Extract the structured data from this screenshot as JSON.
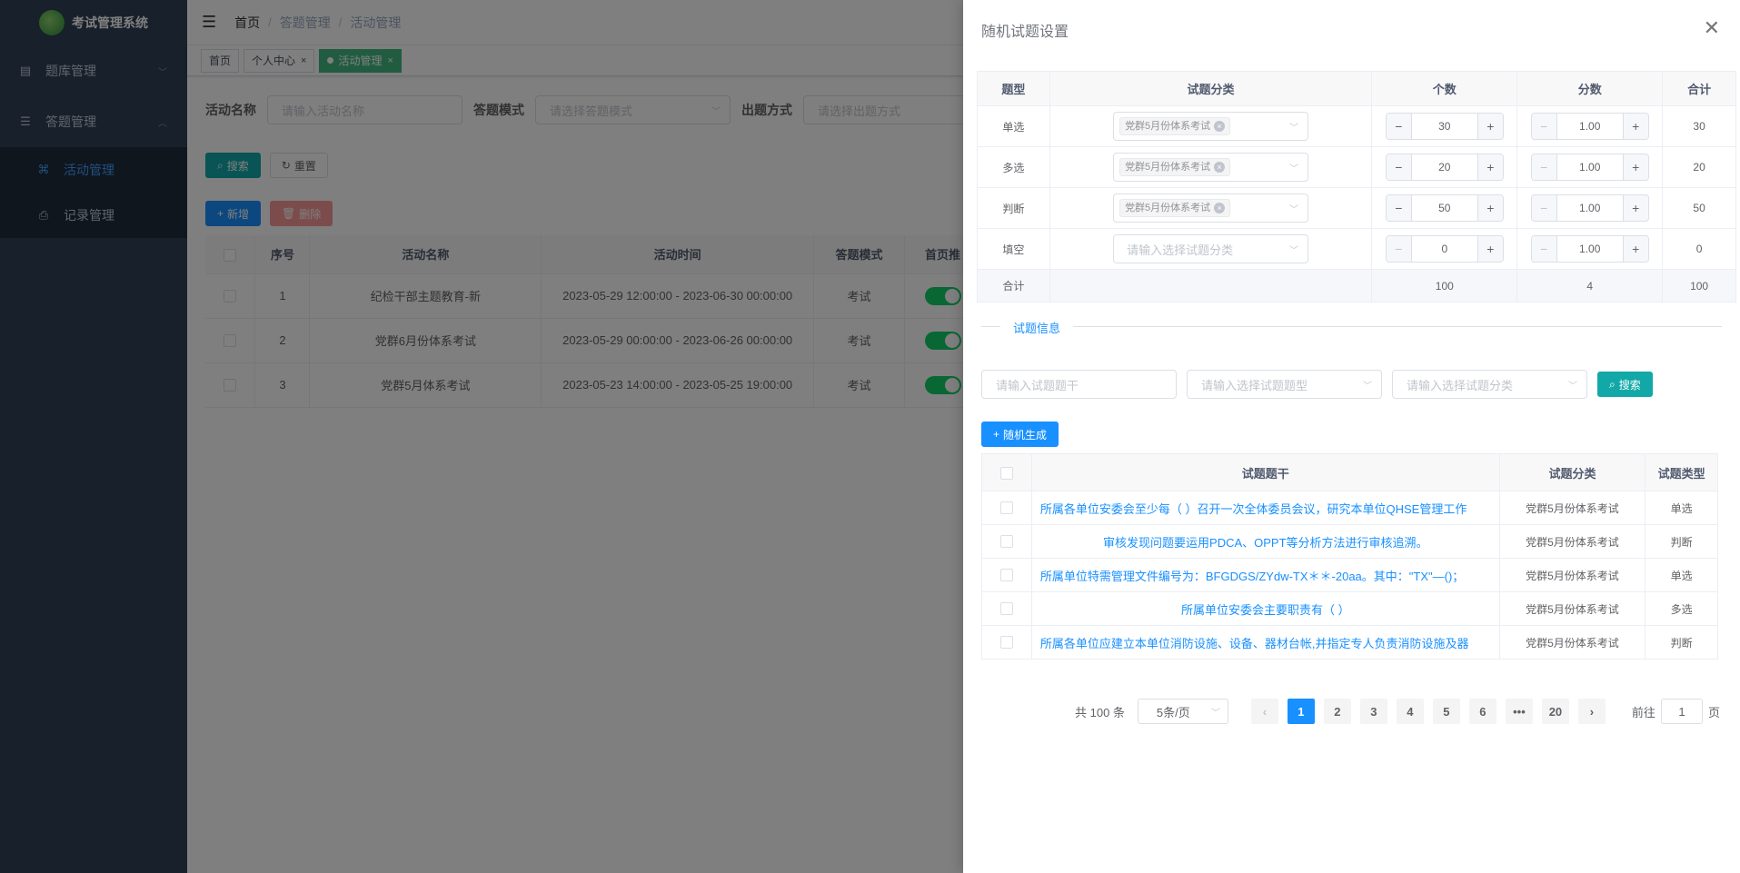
{
  "app": {
    "title": "考试管理系统"
  },
  "sidebar": {
    "items": [
      {
        "label": "题库管理",
        "icon": "database-icon"
      },
      {
        "label": "答题管理",
        "icon": "list-icon",
        "children": [
          {
            "label": "活动管理",
            "icon": "grid-icon",
            "active": true
          },
          {
            "label": "记录管理",
            "icon": "record-icon"
          }
        ]
      }
    ]
  },
  "navbar": {
    "breadcrumb": [
      "首页",
      "答题管理",
      "活动管理"
    ]
  },
  "tags": [
    "首页",
    "个人中心",
    "活动管理"
  ],
  "filters": {
    "name_label": "活动名称",
    "name_placeholder": "请输入活动名称",
    "mode_label": "答题模式",
    "mode_placeholder": "请选择答题模式",
    "method_label": "出题方式",
    "method_placeholder": "请选择出题方式",
    "search": "搜索",
    "reset": "重置",
    "add": "新增",
    "delete": "删除"
  },
  "activity_table": {
    "headers": [
      "序号",
      "活动名称",
      "活动时间",
      "答题模式",
      "首页推"
    ],
    "rows": [
      {
        "no": "1",
        "name": "纪检干部主题教育-新",
        "time": "2023-05-29 12:00:00 - 2023-06-30 00:00:00",
        "mode": "考试"
      },
      {
        "no": "2",
        "name": "党群6月份体系考试",
        "time": "2023-05-29 00:00:00 - 2023-06-26 00:00:00",
        "mode": "考试"
      },
      {
        "no": "3",
        "name": "党群5月体系考试",
        "time": "2023-05-23 14:00:00 - 2023-05-25 19:00:00",
        "mode": "考试"
      }
    ]
  },
  "drawer": {
    "title": "随机试题设置",
    "config": {
      "headers": [
        "题型",
        "试题分类",
        "个数",
        "分数",
        "合计"
      ],
      "rows": [
        {
          "type": "单选",
          "category": "党群5月份体系考试",
          "count": "30",
          "score": "1.00",
          "total": "30"
        },
        {
          "type": "多选",
          "category": "党群5月份体系考试",
          "count": "20",
          "score": "1.00",
          "total": "20"
        },
        {
          "type": "判断",
          "category": "党群5月份体系考试",
          "count": "50",
          "score": "1.00",
          "total": "50"
        },
        {
          "type": "填空",
          "category": "",
          "category_placeholder": "请输入选择试题分类",
          "count": "0",
          "score": "1.00",
          "total": "0"
        }
      ],
      "summary": {
        "label": "合计",
        "count": "100",
        "score": "4",
        "total": "100"
      }
    },
    "section_title": "试题信息",
    "search": {
      "stem_placeholder": "请输入试题题干",
      "type_placeholder": "请输入选择试题题型",
      "category_placeholder": "请输入选择试题分类",
      "search": "搜索",
      "generate": "随机生成"
    },
    "questions": {
      "headers": [
        "试题题干",
        "试题分类",
        "试题类型"
      ],
      "rows": [
        {
          "stem": "所属各单位安委会至少每（ ）召开一次全体委员会议，研究本单位QHSE管理工作",
          "category": "党群5月份体系考试",
          "type": "单选",
          "align": "left"
        },
        {
          "stem": "审核发现问题要运用PDCA、OPPT等分析方法进行审核追溯。",
          "category": "党群5月份体系考试",
          "type": "判断",
          "align": "center"
        },
        {
          "stem": "所属单位特需管理文件编号为：BFGDGS/ZYdw-TX＊＊-20aa。其中：\"TX\"—()；",
          "category": "党群5月份体系考试",
          "type": "单选",
          "align": "left"
        },
        {
          "stem": "所属单位安委会主要职责有（ ）",
          "category": "党群5月份体系考试",
          "type": "多选",
          "align": "center"
        },
        {
          "stem": "所属各单位应建立本单位消防设施、设备、器材台帐,并指定专人负责消防设施及器",
          "category": "党群5月份体系考试",
          "type": "判断",
          "align": "left"
        }
      ]
    },
    "pagination": {
      "total": "共 100 条",
      "page_size": "5条/页",
      "pages": [
        "1",
        "2",
        "3",
        "4",
        "5",
        "6",
        "•••",
        "20"
      ],
      "current": "1",
      "goto_label": "前往",
      "goto_value": "1",
      "goto_suffix": "页"
    }
  }
}
